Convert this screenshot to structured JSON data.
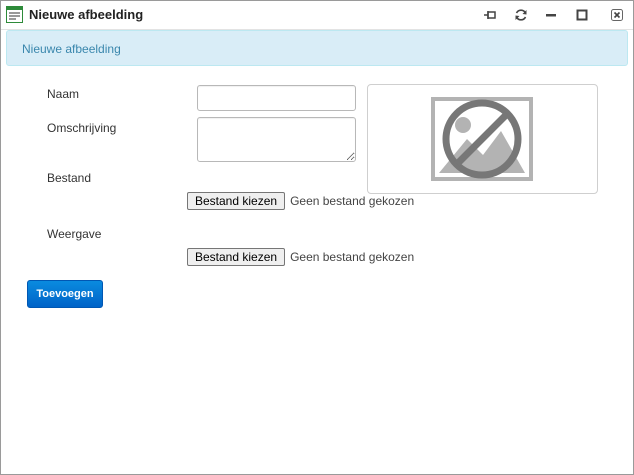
{
  "window": {
    "title": "Nieuwe afbeelding",
    "icon": "form-icon",
    "controls": [
      "pin-icon",
      "refresh-icon",
      "minimize-icon",
      "maximize-icon",
      "close-icon"
    ]
  },
  "banner": {
    "text": "Nieuwe afbeelding"
  },
  "form": {
    "naam_label": "Naam",
    "naam_value": "",
    "omschrijving_label": "Omschrijving",
    "omschrijving_value": "",
    "bestand_label": "Bestand",
    "bestand_button": "Bestand kiezen",
    "bestand_status": "Geen bestand gekozen",
    "weergave_label": "Weergave",
    "weergave_button": "Bestand kiezen",
    "weergave_status": "Geen bestand gekozen",
    "submit_label": "Toevoegen"
  },
  "preview": {
    "icon": "no-image-icon"
  },
  "colors": {
    "banner_bg": "#d9edf7",
    "banner_text": "#3a87ad",
    "primary_button": "#0a74d4",
    "placeholder_gray": "#b3b3b3",
    "placeholder_circle": "#777777"
  }
}
